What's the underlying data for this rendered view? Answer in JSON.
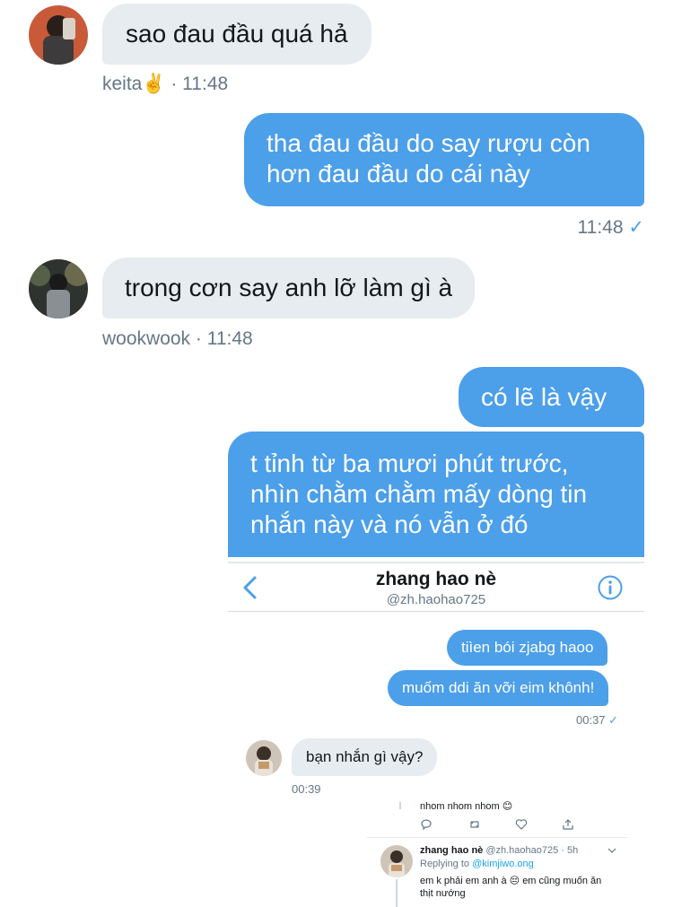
{
  "messages": [
    {
      "text": "sao đau đầu quá hả",
      "sender": "keita",
      "time": "11:48"
    },
    {
      "lines": [
        "tha đau đầu do say rượu còn",
        "hơn đau đầu do cái này"
      ],
      "time": "11:48"
    },
    {
      "text": "trong cơn say anh lỡ làm gì à",
      "sender": "wookwook",
      "time": "11:48"
    },
    {
      "text": "có lẽ là vậy"
    },
    {
      "lines": [
        "t tỉnh từ ba mươi phút trước,",
        "nhìn chằm chằm mấy dòng tin",
        "nhắn này và nó vẫn ở đó"
      ]
    }
  ],
  "meta": {
    "keita": "keita",
    "keita_emoji": "✌️",
    "keita_time": "· 11:48",
    "sent_time": "11:48",
    "check": "✓",
    "wook": "wookwook · 11:48"
  },
  "embed": {
    "title": "zhang hao nè",
    "handle": "@zh.haohao725",
    "messages": [
      {
        "text": "tiìen bói zjabg haoo"
      },
      {
        "text": "muốm ddi ăn vỡi eim khônh!"
      },
      {
        "text": "bạn nhắn gì vậy?"
      }
    ],
    "sent_time": "00:37",
    "check": "✓",
    "recv_time": "00:39",
    "tweet_cut": "nhom nhom nhom 😊",
    "reply": {
      "name": "zhang hao nè",
      "handle_time": "@zh.haohao725 · 5h",
      "replying": "Replying to",
      "replying_to": "@kimjiwo.ong",
      "line1": "em k phải em anh à 😔 em cũng muốn ăn",
      "line2": "thịt nướng"
    }
  },
  "colors": {
    "accent": "#4c9fe9",
    "incoming": "#e6ecf0",
    "muted": "#657786"
  }
}
